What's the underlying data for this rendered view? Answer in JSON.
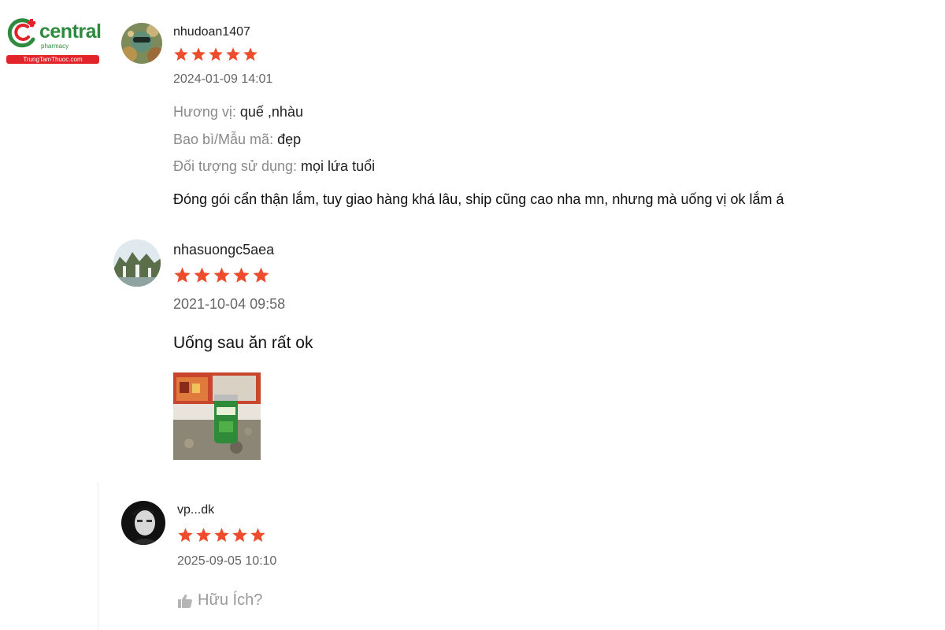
{
  "brand": {
    "name": "central",
    "sub": "pharmacy",
    "site": "TrungTamThuoc.com",
    "primary_color": "#2e8b3e",
    "accent_color": "#e2232a"
  },
  "star_color": "#ee4d2d",
  "reviews": [
    {
      "username": "nhudoan1407",
      "rating": 5,
      "timestamp": "2024-01-09 14:01",
      "attributes": [
        {
          "label": "Hương vị:",
          "value": "quế ,nhàu"
        },
        {
          "label": "Bao bì/Mẫu mã:",
          "value": "đẹp"
        },
        {
          "label": "Đối tượng sử dụng:",
          "value": "mọi lứa tuổi"
        }
      ],
      "comment": "Đóng gói cẩn thận lắm, tuy giao hàng khá lâu, ship cũng cao nha mn, nhưng mà uống vị ok lắm á",
      "avatar_icon": "user-avatar"
    },
    {
      "username": "nhasuongc5aea",
      "rating": 5,
      "timestamp": "2021-10-04 09:58",
      "comment": "Uống sau ăn rất ok",
      "avatar_icon": "user-avatar",
      "has_photo": true
    },
    {
      "username": "vp...dk",
      "rating": 5,
      "timestamp": "2025-09-05 10:10",
      "avatar_icon": "user-avatar",
      "helpful_label": "Hữu Ích?",
      "helpful_icon": "thumbs-up-icon"
    }
  ]
}
